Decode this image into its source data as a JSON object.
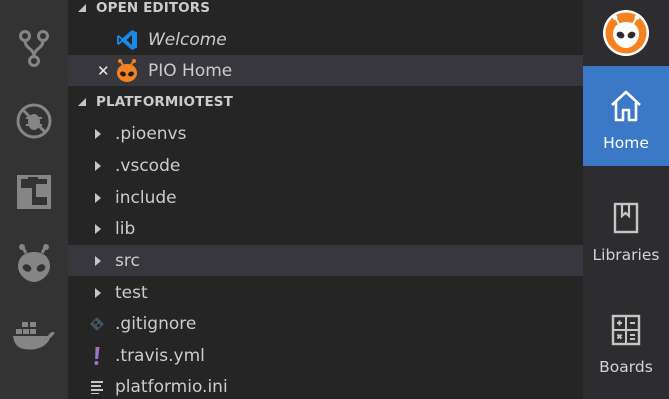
{
  "activity_bar": {
    "items": [
      {
        "icon": "source-control-icon"
      },
      {
        "icon": "debug-icon"
      },
      {
        "icon": "extensions-icon"
      },
      {
        "icon": "platformio-alien-icon"
      },
      {
        "icon": "docker-icon"
      }
    ]
  },
  "explorer": {
    "open_editors": {
      "title": "OPEN EDITORS",
      "items": [
        {
          "label": "Welcome",
          "icon": "vscode-icon",
          "italic": true
        },
        {
          "label": "PIO Home",
          "icon": "platformio-icon",
          "close": "✕"
        }
      ]
    },
    "project": {
      "title": "PLATFORMIOTEST",
      "folders": [
        {
          "label": ".pioenvs"
        },
        {
          "label": ".vscode"
        },
        {
          "label": "include"
        },
        {
          "label": "lib"
        },
        {
          "label": "src"
        },
        {
          "label": "test"
        }
      ],
      "files": [
        {
          "label": ".gitignore",
          "icon": "git-diamond-icon"
        },
        {
          "label": ".travis.yml",
          "icon": "exclamation-icon"
        },
        {
          "label": "platformio.ini",
          "icon": "lines-icon"
        }
      ]
    }
  },
  "pio_panel": {
    "logo": "platformio-logo",
    "nav": [
      {
        "label": "Home",
        "icon": "home-icon",
        "active": true
      },
      {
        "label": "Libraries",
        "icon": "book-icon",
        "active": false
      },
      {
        "label": "Boards",
        "icon": "calculator-icon",
        "active": false
      }
    ]
  },
  "colors": {
    "activity_bar_bg": "#333333",
    "sidebar_bg": "#252526",
    "selected_row": "#37373d",
    "pio_active": "#3b78c5",
    "pio_orange": "#f5821f",
    "vscode_blue": "#1a8ae6",
    "yaml_purple": "#a074c4"
  }
}
